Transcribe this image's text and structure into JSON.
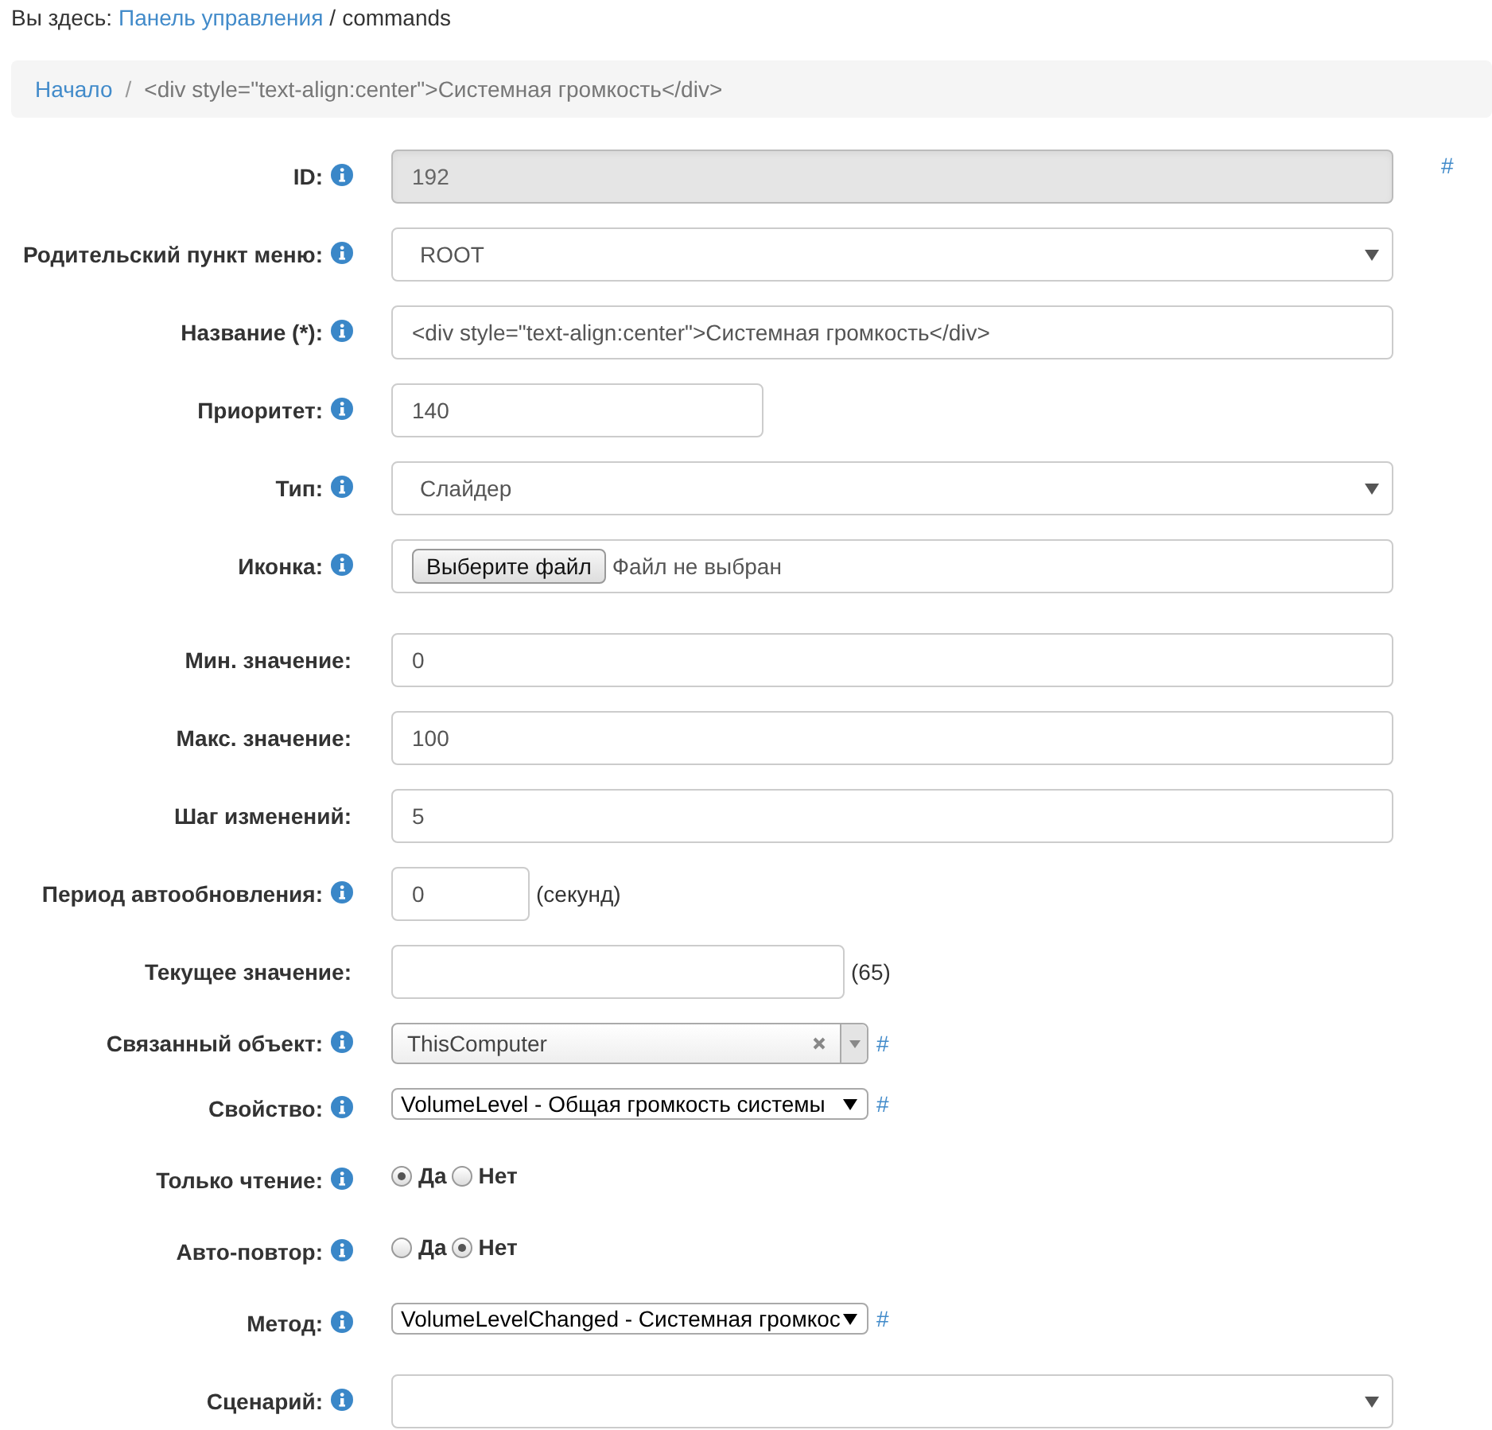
{
  "breadcrumb": {
    "prefix": "Вы здесь:",
    "link": "Панель управления",
    "separator": "/",
    "current": "commands"
  },
  "crumbs": {
    "separator": "/",
    "items": [
      {
        "label": "Начало",
        "link": true
      },
      {
        "label": "<div style=\"text-align:center\">Системная громкость</div>",
        "link": false
      }
    ]
  },
  "fields": [
    {
      "label": "ID:",
      "info": true,
      "kind": "wide",
      "value": "192",
      "disabled": true,
      "hash": "#"
    },
    {
      "label": "Родительский пункт меню:",
      "info": true,
      "kind": "select",
      "value": "ROOT"
    },
    {
      "label": "Название (*):",
      "info": true,
      "kind": "wide",
      "value": "<div style=\"text-align:center\">Системная громкость</div>",
      "disabled": false
    },
    {
      "label": "Приоритет:",
      "info": true,
      "kind": "medium",
      "value": "140",
      "disabled": false
    },
    {
      "label": "Тип:",
      "info": true,
      "kind": "select",
      "value": "Слайдер"
    },
    {
      "label": "Иконка:",
      "info": true,
      "kind": "file",
      "button": "Выберите файл",
      "status": "Файл не выбран"
    },
    {
      "label": "Мин. значение:",
      "info": false,
      "kind": "wide",
      "value": "0",
      "disabled": false
    },
    {
      "label": "Макс. значение:",
      "info": false,
      "kind": "wide",
      "value": "100",
      "disabled": false
    },
    {
      "label": "Шаг изменений:",
      "info": false,
      "kind": "wide",
      "value": "5",
      "disabled": false
    },
    {
      "label": "Период автообновления:",
      "info": true,
      "kind": "tiny",
      "value": "0",
      "disabled": false,
      "suffix": "(секунд)"
    },
    {
      "label": "Текущее значение:",
      "info": false,
      "kind": "half",
      "disabled": false,
      "suffix": "(65)"
    },
    {
      "label": "Связанный объект:",
      "info": true,
      "kind": "combo",
      "value": "ThisComputer",
      "hash": "#"
    },
    {
      "label": "Свойство:",
      "info": true,
      "kind": "native",
      "value": "VolumeLevel - Общая громкость системы",
      "hash": "#"
    },
    {
      "label": "Только чтение:",
      "info": true,
      "kind": "radio",
      "options": [
        {
          "label": "Да",
          "selected": true
        },
        {
          "label": "Нет",
          "selected": false
        }
      ]
    },
    {
      "label": "Авто-повтор:",
      "info": true,
      "kind": "radio",
      "options": [
        {
          "label": "Да",
          "selected": false
        },
        {
          "label": "Нет",
          "selected": true
        }
      ]
    },
    {
      "label": "Метод:",
      "info": true,
      "kind": "native",
      "value": "VolumeLevelChanged - Системная громкос",
      "hash": "#"
    },
    {
      "label": "Сценарий:",
      "info": true,
      "kind": "select"
    }
  ]
}
